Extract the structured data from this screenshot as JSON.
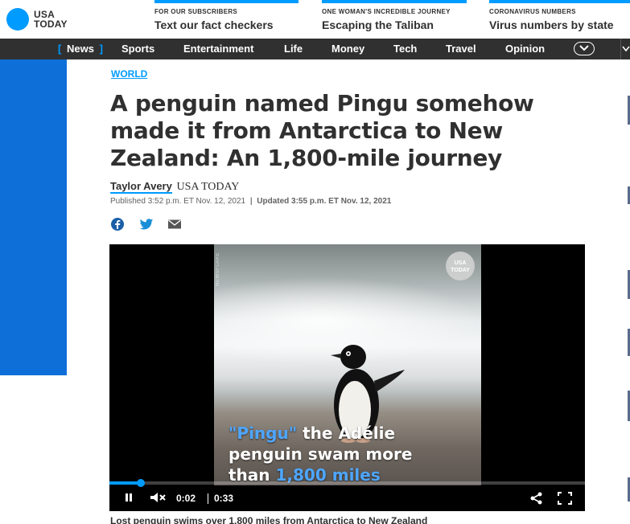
{
  "header": {
    "logo_line1": "USA",
    "logo_line2": "TODAY",
    "promos": [
      {
        "kicker": "FOR OUR SUBSCRIBERS",
        "headline": "Text our fact checkers"
      },
      {
        "kicker": "ONE WOMAN'S INCREDIBLE JOURNEY",
        "headline": "Escaping the Taliban"
      },
      {
        "kicker": "CORONAVIRUS NUMBERS",
        "headline": "Virus numbers by state"
      }
    ]
  },
  "nav": {
    "items": [
      "News",
      "Sports",
      "Entertainment",
      "Life",
      "Money",
      "Tech",
      "Travel",
      "Opinion"
    ],
    "active": "News",
    "bracket_open": "[",
    "bracket_close": "]"
  },
  "article": {
    "section": "WORLD",
    "title": "A penguin named Pingu somehow made it from Antarctica to New Zealand: An 1,800-mile journey",
    "author": "Taylor Avery",
    "outlet": "USA TODAY",
    "published": "Published 3:52 p.m. ET Nov. 12, 2021",
    "separator": "|",
    "updated": "Updated 3:55 p.m. ET Nov. 12, 2021"
  },
  "video": {
    "badge_line1": "USA",
    "badge_line2": "TODAY",
    "watermark": "NEWSFLARE",
    "caption_hl1": "\"Pingu\"",
    "caption_part1": " the Adélie",
    "caption_part2": "penguin swam more",
    "caption_part3": "than ",
    "caption_hl2": "1,800 miles",
    "current_time": "0:02",
    "duration": "0:33",
    "progress": 0.066,
    "caption_below": "Lost penguin swims over 1,800 miles from Antarctica to New Zealand"
  },
  "colors": {
    "brand_blue": "#009bff",
    "nav_bg": "#303030",
    "side_block": "#0f6fd8"
  }
}
